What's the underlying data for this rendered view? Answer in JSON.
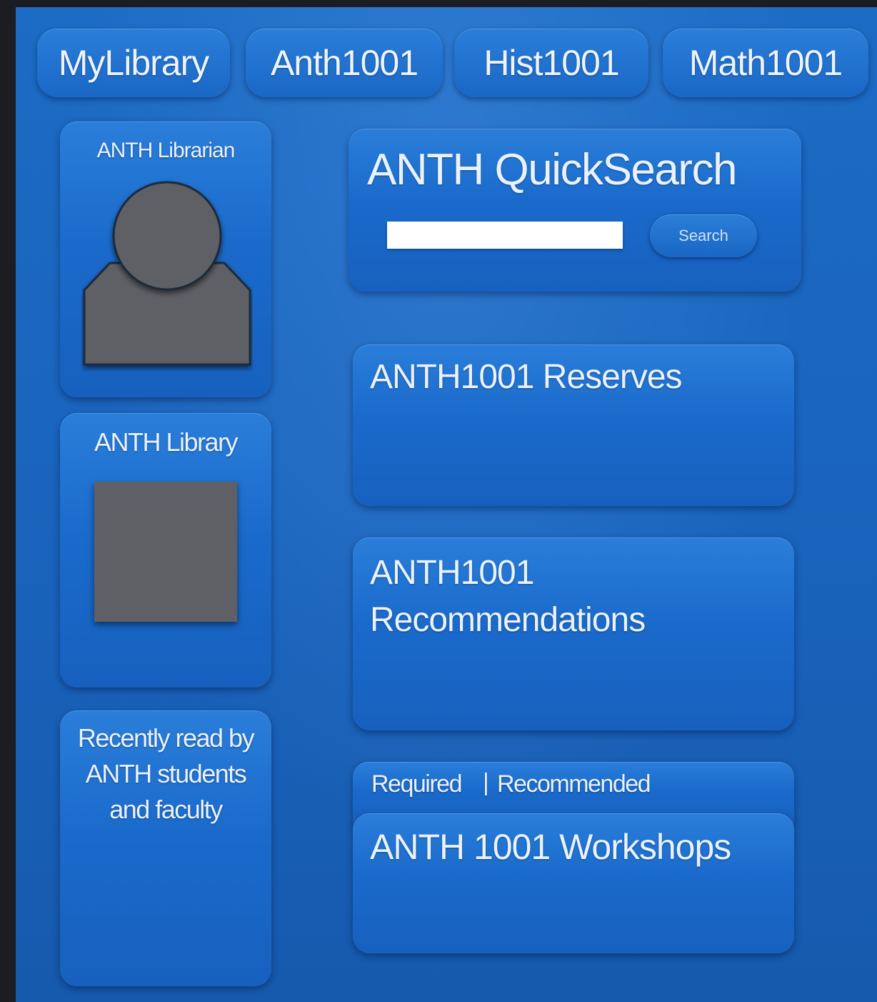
{
  "tabs": [
    {
      "label": "MyLibrary"
    },
    {
      "label": "Anth1001"
    },
    {
      "label": "Hist1001"
    },
    {
      "label": "Math1001"
    }
  ],
  "sidebar": {
    "librarian": {
      "title": "ANTH Librarian",
      "icon": "person-silhouette-icon"
    },
    "library": {
      "title": "ANTH Library",
      "icon": "image-placeholder-icon"
    },
    "recent": {
      "title": "Recently read by ANTH students and faculty"
    }
  },
  "quicksearch": {
    "title": "ANTH QuickSearch",
    "input_value": "",
    "button_label": "Search"
  },
  "reserves": {
    "title": "ANTH1001 Reserves"
  },
  "recommendations": {
    "title_line1": "ANTH1001",
    "title_line2": "Recommendations"
  },
  "filter": {
    "required": "Required",
    "separator": "|",
    "recommended": "Recommended"
  },
  "workshops": {
    "title": "ANTH 1001 Workshops"
  },
  "colors": {
    "background": "#1a64bd",
    "panel": "#1a6acb",
    "placeholder": "#5f6066",
    "frame": "#1b1d22"
  }
}
